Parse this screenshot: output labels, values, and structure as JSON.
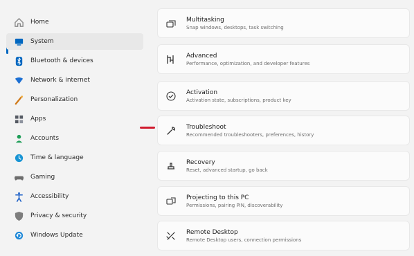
{
  "sidebar": {
    "items": [
      {
        "label": "Home",
        "icon": "home-icon",
        "color": "#8b8b8b",
        "selected": false
      },
      {
        "label": "System",
        "icon": "system-icon",
        "color": "#0067c0",
        "selected": true
      },
      {
        "label": "Bluetooth & devices",
        "icon": "bluetooth-icon",
        "color": "#0067c0",
        "selected": false
      },
      {
        "label": "Network & internet",
        "icon": "network-icon",
        "color": "#1b6fd3",
        "selected": false
      },
      {
        "label": "Personalization",
        "icon": "personalization-icon",
        "color": "#d07a1a",
        "selected": false
      },
      {
        "label": "Apps",
        "icon": "apps-icon",
        "color": "#555a63",
        "selected": false
      },
      {
        "label": "Accounts",
        "icon": "accounts-icon",
        "color": "#1d9d57",
        "selected": false
      },
      {
        "label": "Time & language",
        "icon": "time-language-icon",
        "color": "#1894d4",
        "selected": false
      },
      {
        "label": "Gaming",
        "icon": "gaming-icon",
        "color": "#6d6d6d",
        "selected": false
      },
      {
        "label": "Accessibility",
        "icon": "accessibility-icon",
        "color": "#1b5fc7",
        "selected": false
      },
      {
        "label": "Privacy & security",
        "icon": "privacy-security-icon",
        "color": "#7d7d7d",
        "selected": false
      },
      {
        "label": "Windows Update",
        "icon": "windows-update-icon",
        "color": "#1e88d8",
        "selected": false
      }
    ]
  },
  "settings_cards": [
    {
      "title": "Multitasking",
      "description": "Snap windows, desktops, task switching",
      "icon": "multitasking-icon"
    },
    {
      "title": "Advanced",
      "description": "Performance, optimization, and developer features",
      "icon": "advanced-icon"
    },
    {
      "title": "Activation",
      "description": "Activation state, subscriptions, product key",
      "icon": "activation-icon"
    },
    {
      "title": "Troubleshoot",
      "description": "Recommended troubleshooters, preferences, history",
      "icon": "troubleshoot-icon"
    },
    {
      "title": "Recovery",
      "description": "Reset, advanced startup, go back",
      "icon": "recovery-icon"
    },
    {
      "title": "Projecting to this PC",
      "description": "Permissions, pairing PIN, discoverability",
      "icon": "projecting-icon"
    },
    {
      "title": "Remote Desktop",
      "description": "Remote Desktop users, connection permissions",
      "icon": "remote-desktop-icon"
    }
  ],
  "colors": {
    "accent": "#0067c0",
    "highlight_marker": "#d01a2d",
    "background": "#f3f3f3",
    "card": "#fbfbfb"
  }
}
